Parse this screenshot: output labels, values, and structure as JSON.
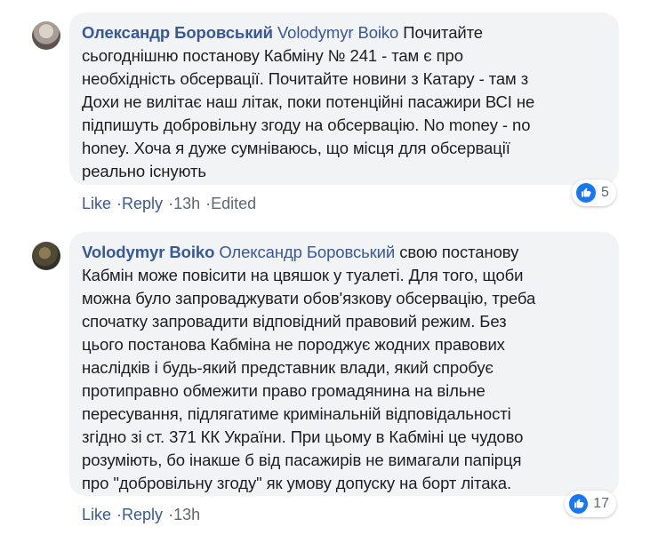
{
  "comments": [
    {
      "author": "Олександр Боровський",
      "mention": "Volodymyr Boiko",
      "lines": [
        "Почитайте",
        "сьогоднішню постанову Кабміну № 241 - там є про",
        "необхідність обсервації. Почитайте новини з Катару - там з",
        "Дохи не вилітає наш літак, поки потенційні пасажири ВСІ не",
        "підпишуть добровільну згоду на обсервацію. No money - no",
        "honey. Хоча я дуже сумніваюсь, що місця для обсервації",
        "реально існують"
      ],
      "actions": {
        "like": "Like",
        "reply": "Reply",
        "time": "13h",
        "edited": "Edited"
      },
      "reaction_count": "5"
    },
    {
      "author": "Volodymyr Boiko",
      "mention": "Олександр Боровський",
      "lines": [
        "свою постанову",
        "Кабмін може повісити на цвяшок у туалеті. Для того, щоби",
        "можна було запроваджувати обов'язкову обсервацію, треба",
        "спочатку запровадити відповідний правовий режим. Без",
        "цього постанова Кабміна не породжує жодних правових",
        "наслідків і будь-який представник влади, який спробує",
        "протиправно обмежити право громадянина на вільне",
        "пересування, підлягатиме кримінальній відповідальності",
        "згідно зі ст. 371 КК України. При цьому в Кабміні це чудово",
        "розуміють, бо інакше б від пасажирів не вимагали папірця",
        "про \"добровільну згоду\" як умову допуску на борт літака."
      ],
      "actions": {
        "like": "Like",
        "reply": "Reply",
        "time": "13h"
      },
      "reaction_count": "17"
    }
  ],
  "colors": {
    "link": "#385898",
    "bubble": "#f2f3f5",
    "like": "#1877f2",
    "meta": "#606770"
  },
  "icons": {
    "reaction": "like-icon"
  }
}
